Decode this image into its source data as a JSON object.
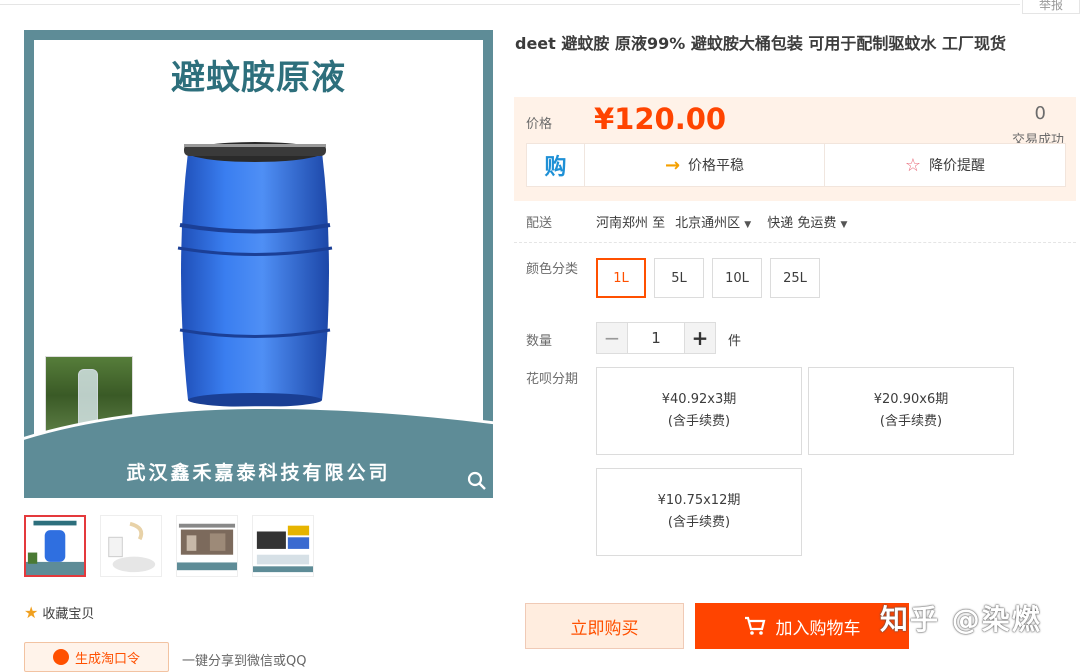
{
  "top": {
    "report_label": "举报"
  },
  "image": {
    "title_text": "避蚊胺原液",
    "company_text": "武汉鑫禾嘉泰科技有限公司"
  },
  "favorite_label": "收藏宝贝",
  "generate_label": "生成淘口令",
  "share_label": "一键分享到微信或QQ",
  "product": {
    "title": "deet 避蚊胺 原液99% 避蚊胺大桶包装 可用于配制驱蚊水 工厂现货"
  },
  "price": {
    "label": "价格",
    "value": "¥120.00",
    "sold_count": "0",
    "sold_label": "交易成功"
  },
  "promo": {
    "gou_icon_text": "购",
    "stable_label": "价格平稳",
    "alert_label": "降价提醒"
  },
  "delivery": {
    "label": "配送",
    "from": "河南郑州 至",
    "to": "北京通州区",
    "method": "快递 免运费"
  },
  "color": {
    "label": "颜色分类",
    "options": [
      "1L",
      "5L",
      "10L",
      "25L"
    ],
    "selected": "1L"
  },
  "quantity": {
    "label": "数量",
    "minus": "−",
    "value": "1",
    "plus": "+",
    "unit": "件"
  },
  "installment": {
    "label": "花呗分期",
    "plans": [
      {
        "amount": "¥40.92x3期",
        "fee": "(含手续费)"
      },
      {
        "amount": "¥20.90x6期",
        "fee": "(含手续费)"
      },
      {
        "amount": "¥10.75x12期",
        "fee": "(含手续费)"
      }
    ]
  },
  "actions": {
    "buy_now": "立即购买",
    "add_cart": "加入购物车"
  },
  "watermark": "知乎 @染燃",
  "colors": {
    "accent": "#ff4400",
    "barrel": "#2f6fe0",
    "frame": "#5e8c97"
  }
}
